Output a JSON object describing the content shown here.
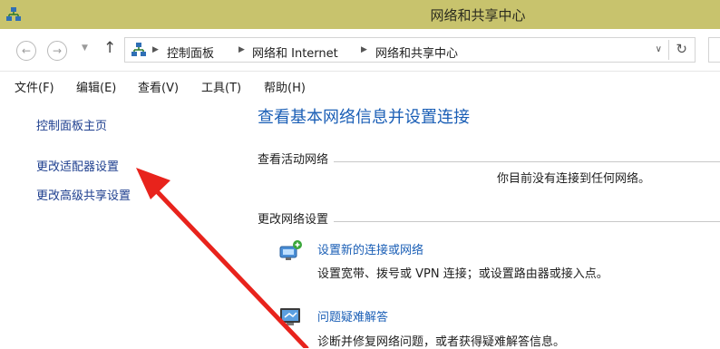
{
  "window": {
    "title": "网络和共享中心"
  },
  "address_bar": {
    "crumbs": [
      "控制面板",
      "网络和 Internet",
      "网络和共享中心"
    ]
  },
  "menu": [
    "文件(F)",
    "编辑(E)",
    "查看(V)",
    "工具(T)",
    "帮助(H)"
  ],
  "left_nav": {
    "items": [
      "控制面板主页",
      "更改适配器设置",
      "更改高级共享设置"
    ]
  },
  "main": {
    "title": "查看基本网络信息并设置连接",
    "active_networks": {
      "label": "查看活动网络",
      "status": "你目前没有连接到任何网络。"
    },
    "change_settings": {
      "label": "更改网络设置",
      "tasks": [
        {
          "link": "设置新的连接或网络",
          "desc": "设置宽带、拨号或 VPN 连接；或设置路由器或接入点。",
          "icon": "network-setup-icon"
        },
        {
          "link": "问题疑难解答",
          "desc": "诊断并修复网络问题，或者获得疑难解答信息。",
          "icon": "troubleshoot-icon"
        }
      ]
    }
  },
  "colors": {
    "titlebar": "#c8c36d",
    "link": "#1b5fb6",
    "annotation_arrow": "#e8231c"
  }
}
